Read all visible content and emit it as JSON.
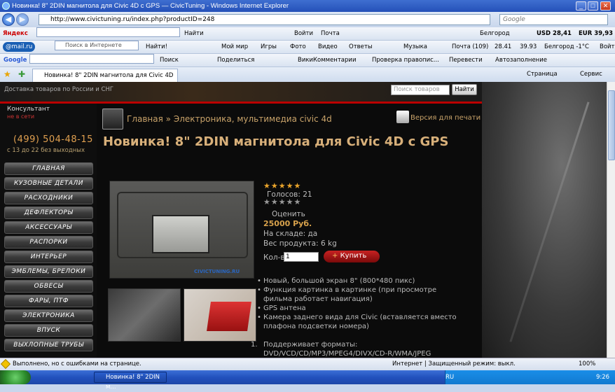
{
  "window": {
    "title": "Новинка! 8\" 2DIN магнитола для Civic 4D с GPS — CivicTuning - Windows Internet Explorer"
  },
  "address": {
    "url": "http://www.civictuning.ru/index.php?productID=248",
    "search_placeholder": "Google"
  },
  "yandex_bar": {
    "brand": "Яндекс",
    "find": "Найти",
    "login": "Войти",
    "mail": "Почта",
    "city": "Белгород",
    "usd": "USD 28,41",
    "eur": "EUR 39,93"
  },
  "mailru_bar": {
    "brand": "@mail.ru",
    "search_placeholder": "Поиск в Интернете",
    "find": "Найти!",
    "moy_mir": "Мой мир",
    "games": "Игры",
    "photo": "Фото",
    "video": "Видео",
    "answers": "Ответы",
    "music": "Музыка",
    "mail_count": "Почта (109)",
    "usd": "28.41",
    "eur": "39.93",
    "weather": "Белгород -1°C",
    "login": "Войти"
  },
  "google_bar": {
    "brand": "Google",
    "search": "Поиск",
    "share": "Поделиться",
    "wiki": "ВикиКомментарии",
    "spell": "Проверка правопис...",
    "translate": "Перевести",
    "autofill": "Автозаполнение"
  },
  "tabs": {
    "active_label": "Новинка! 8\" 2DIN магнитола для Civic 4D с GPS ...",
    "page": "Страница",
    "service": "Сервис"
  },
  "site": {
    "delivery": "Доставка товаров по России и СНГ",
    "search_placeholder": "Поиск товаров",
    "search_btn": "Найти",
    "consultant": "Консультант",
    "consultant_status": "не в сети",
    "phone": "(499) 504-48-15",
    "hours": "с 13 до 22 без выходных",
    "menu": [
      "ГЛАВНАЯ",
      "КУЗОВНЫЕ ДЕТАЛИ",
      "РАСХОДНИКИ",
      "ДЕФЛЕКТОРЫ",
      "АКСЕССУАРЫ",
      "РАСПОРКИ",
      "ИНТЕРЬЕР",
      "ЭМБЛЕМЫ, БРЕЛОКИ",
      "ОБВЕСЫ",
      "ФАРЫ, ПТФ",
      "ЭЛЕКТРОНИКА",
      "ВПУСК",
      "ВЫХЛОПНЫЕ ТРУБЫ"
    ]
  },
  "product": {
    "breadcrumb_home": "Главная",
    "breadcrumb_sep": "»",
    "breadcrumb_cat": "Электроника, мультимедиа civic 4d",
    "print": "Версия для печати",
    "title": "Новинка! 8\" 2DIN магнитола для Civic 4D с GPS",
    "stars_filled": "★★★★★",
    "votes": "Голосов: 21",
    "stars_empty": "★★★★★",
    "rate": "Оценить",
    "price": "25000 Руб.",
    "stock": "На складе: да",
    "weight": "Вес продукта: 6 kg",
    "qty_label": "Кол-во:",
    "qty_value": "1",
    "buy": "Купить",
    "logo_text": "CIVICTUNING.RU",
    "features": [
      "Новый, большой экран 8\" (800*480 пикс)",
      "Функция картинка в картинке (при просмотре фильма работает навигация)",
      "GPS антена",
      "Камера заднего вида для Civic (вставляется вместо плафона подсветки номера)"
    ],
    "ordered_num": "1.",
    "ordered_text": "Поддерживает форматы: DVD/VCD/CD/MP3/MPEG4/DIVX/CD-R/WMA/JPEG"
  },
  "status": {
    "text": "Выполнено, но с ошибками на странице.",
    "zone": "Интернет | Защищенный режим: выкл.",
    "zoom": "100%"
  },
  "taskbar": {
    "task": "Новинка! 8\" 2DIN м...",
    "lang": "RU",
    "time": "9:26"
  }
}
